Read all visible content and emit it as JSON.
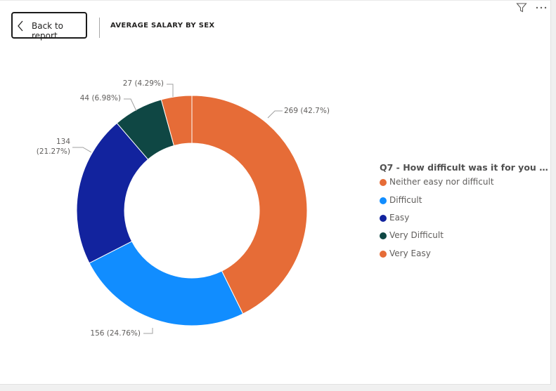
{
  "header": {
    "back_label": "Back to report",
    "title": "AVERAGE SALARY BY SEX",
    "icons": [
      "filter-icon",
      "more-options-icon"
    ]
  },
  "legend": {
    "title": "Q7 - How difficult was it for you to b...",
    "items": [
      {
        "label": "Neither easy nor difficult",
        "color": "#E66C37"
      },
      {
        "label": "Difficult",
        "color": "#118DFF"
      },
      {
        "label": "Easy",
        "color": "#12239E"
      },
      {
        "label": "Very Difficult",
        "color": "#0F4744"
      },
      {
        "label": "Very Easy",
        "color": "#E66C37"
      }
    ]
  },
  "chart_data": {
    "type": "donut",
    "legend_position": "right",
    "slices": [
      {
        "name": "Neither easy nor difficult",
        "value": 269,
        "percent": 42.7,
        "label": "269 (42.7%)",
        "color": "#E66C37"
      },
      {
        "name": "Difficult",
        "value": 156,
        "percent": 24.76,
        "label": "156 (24.76%)",
        "color": "#118DFF"
      },
      {
        "name": "Easy",
        "value": 134,
        "percent": 21.27,
        "label": [
          "134",
          "(21.27%)"
        ],
        "color": "#12239E"
      },
      {
        "name": "Very Difficult",
        "value": 44,
        "percent": 6.98,
        "label": "44 (6.98%)",
        "color": "#0F4744"
      },
      {
        "name": "Very Easy",
        "value": 27,
        "percent": 4.29,
        "label": "27 (4.29%)",
        "color": "#E66C37"
      }
    ]
  }
}
